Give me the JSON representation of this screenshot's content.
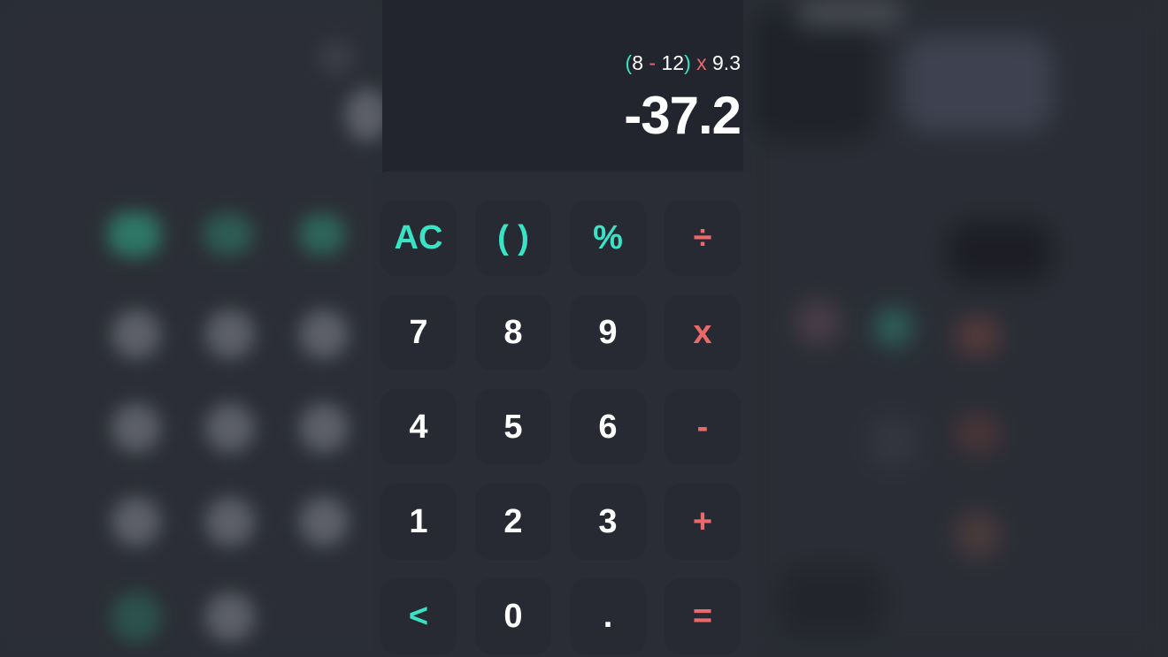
{
  "display": {
    "expression": [
      {
        "text": "(",
        "kind": "paren"
      },
      {
        "text": "8 ",
        "kind": "num"
      },
      {
        "text": "-",
        "kind": "op"
      },
      {
        "text": " 12",
        "kind": "num"
      },
      {
        "text": ")",
        "kind": "paren"
      },
      {
        "text": " x",
        "kind": "op"
      },
      {
        "text": " 9.3",
        "kind": "num"
      }
    ],
    "result": "-37.2"
  },
  "keys": {
    "clear": "AC",
    "parens": "( )",
    "percent": "%",
    "divide": "÷",
    "seven": "7",
    "eight": "8",
    "nine": "9",
    "multiply": "x",
    "four": "4",
    "five": "5",
    "six": "6",
    "minus": "-",
    "one": "1",
    "two": "2",
    "three": "3",
    "plus": "+",
    "backspace": "<",
    "zero": "0",
    "decimal": ".",
    "equals": "="
  },
  "colors": {
    "accent_teal": "#3ae3c6",
    "accent_red": "#e86a6a",
    "key_bg": "#272a32",
    "panel_bg": "#2a2d35",
    "display_bg": "#22252d"
  }
}
